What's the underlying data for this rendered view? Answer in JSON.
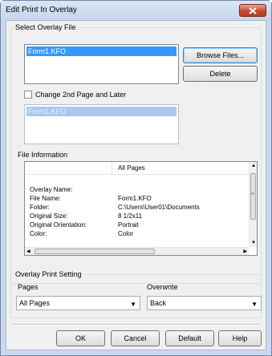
{
  "window": {
    "title": "Edit Print In Overlay"
  },
  "select_overlay": {
    "group_label": "Select Overlay File",
    "files": [
      "Form1.KFO"
    ],
    "browse_label": "Browse Files...",
    "delete_label": "Delete"
  },
  "second_page": {
    "checkbox_label": "Change 2nd Page and Later",
    "checked": false,
    "files": [
      "Form1.KFO"
    ]
  },
  "file_info": {
    "group_label": "File Information",
    "column_header": "All Pages",
    "rows": [
      {
        "label": "Overlay Name:",
        "value": ""
      },
      {
        "label": "File Name:",
        "value": "Form1.KFO"
      },
      {
        "label": "Folder:",
        "value": "C:\\Users\\User01\\Documents"
      },
      {
        "label": "Original Size:",
        "value": "8 1/2x11"
      },
      {
        "label": "Original Orientation:",
        "value": "Portrait"
      },
      {
        "label": "Color:",
        "value": "Color"
      }
    ]
  },
  "print_setting": {
    "group_label": "Overlay Print Setting",
    "pages_label": "Pages",
    "pages_value": "All Pages",
    "overwrite_label": "Overwrite",
    "overwrite_value": "Back"
  },
  "footer": {
    "ok_label": "OK",
    "cancel_label": "Cancel",
    "default_label": "Default",
    "help_label": "Help"
  }
}
